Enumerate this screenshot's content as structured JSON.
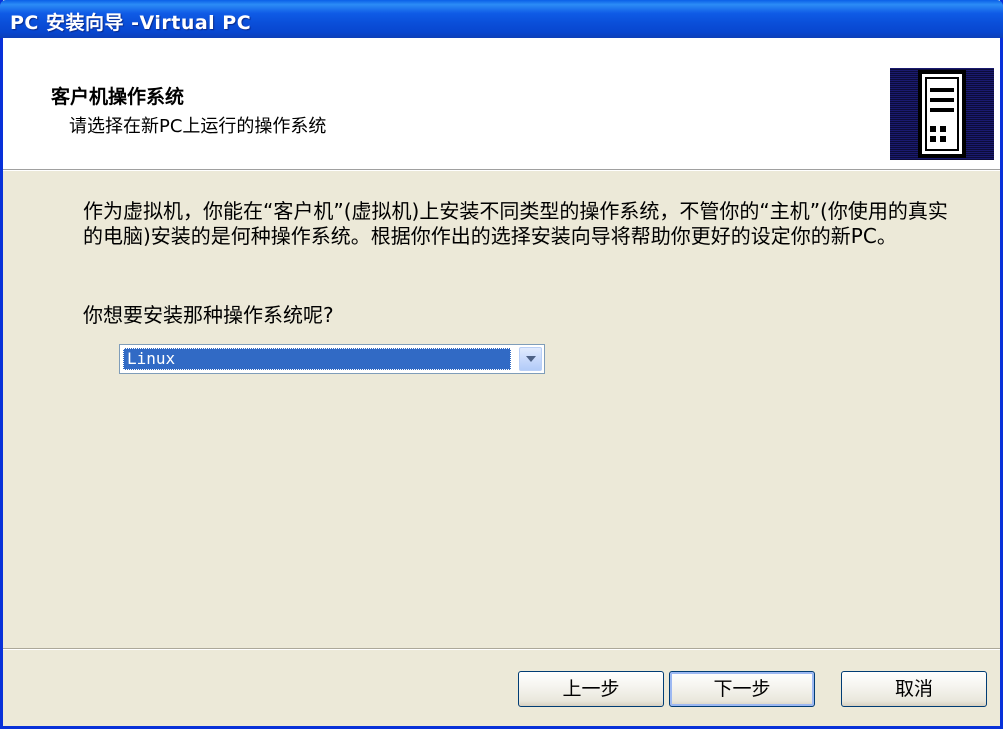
{
  "window": {
    "title": "PC 安装向导 -Virtual PC"
  },
  "header": {
    "title": "客户机操作系统",
    "subtitle": "请选择在新PC上运行的操作系统",
    "icon": "server-tower-icon"
  },
  "main": {
    "intro": "作为虚拟机，你能在“客户机”(虚拟机)上安装不同类型的操作系统，不管你的“主机”(你使用的真实的电脑)安装的是何种操作系统。根据你作出的选择安装向导将帮助你更好的设定你的新PC。",
    "question": "你想要安装那种操作系统呢?",
    "os_select": {
      "selected": "Linux"
    }
  },
  "buttons": {
    "back": "上一步",
    "next": "下一步",
    "cancel": "取消"
  },
  "colors": {
    "titlebar": "#0a4fd9",
    "dialog_bg": "#ece9d8",
    "selection": "#316ac5"
  }
}
